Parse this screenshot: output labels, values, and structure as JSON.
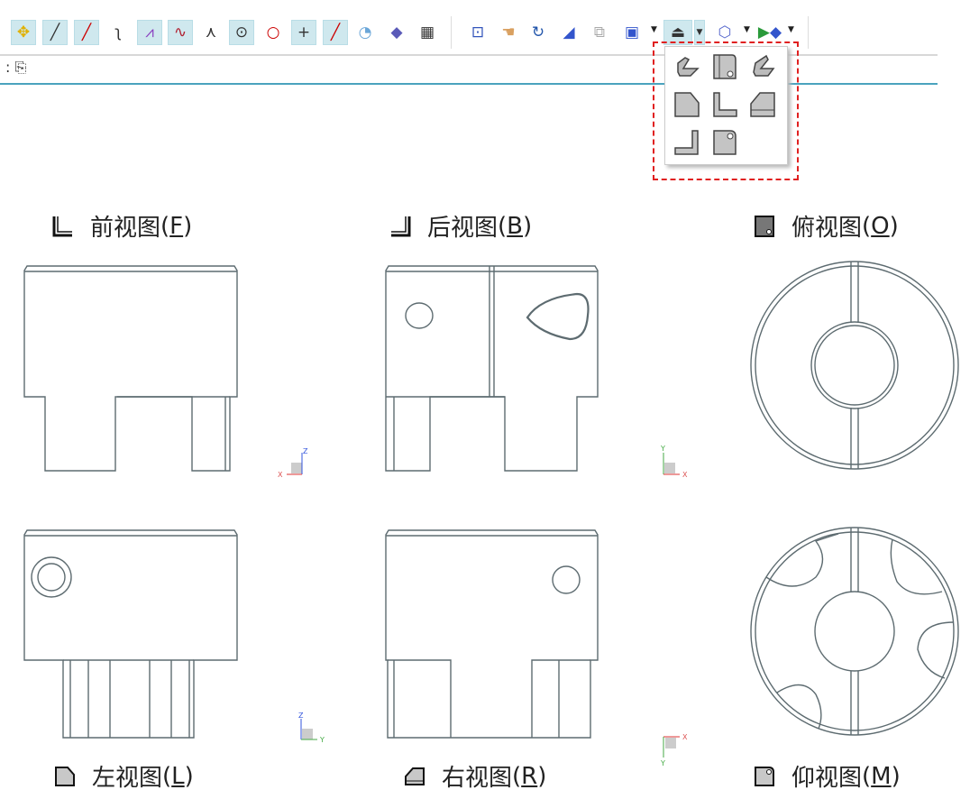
{
  "toolbar": {
    "icons": [
      "snap-points-icon",
      "line-icon",
      "line-midpoint-icon",
      "curve-icon",
      "polyline-icon",
      "spline-icon",
      "intersection-icon",
      "circle-center-icon",
      "circle-points-icon",
      "crosshair-icon",
      "line-segment-icon",
      "surface-point-icon",
      "face-point-icon",
      "grid-point-icon",
      "zoom-window-icon",
      "pan-icon",
      "rotate-icon",
      "look-at-icon",
      "layout-icon",
      "fit-view-icon",
      "standard-views-icon",
      "cube-view-icon",
      "render-mode-icon"
    ]
  },
  "subbar": {
    "icon": "clipboard-icon"
  },
  "popup": {
    "items": [
      "isometric-view",
      "top-view",
      "dimetric-view",
      "left-view",
      "front-view",
      "right-view",
      "back-view",
      "bottom-view"
    ]
  },
  "views": {
    "front": {
      "name": "前视图",
      "key": "F"
    },
    "back": {
      "name": "后视图",
      "key": "B"
    },
    "top": {
      "name": "俯视图",
      "key": "O"
    },
    "left": {
      "name": "左视图",
      "key": "L"
    },
    "right": {
      "name": "右视图",
      "key": "R"
    },
    "bottom": {
      "name": "仰视图",
      "key": "M"
    }
  },
  "axes": {
    "x": "X",
    "y": "Y",
    "z": "Z"
  },
  "colors": {
    "accent": "#4aa3be",
    "highlight": "#e02020"
  }
}
